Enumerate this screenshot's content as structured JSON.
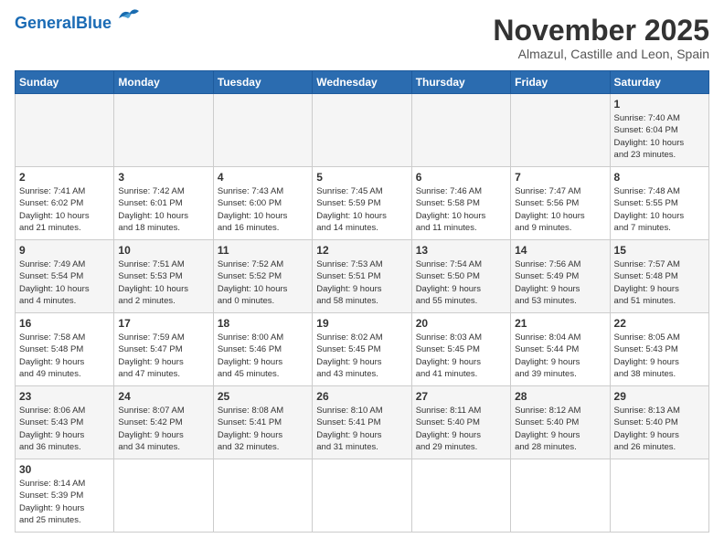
{
  "header": {
    "logo_line1": "General",
    "logo_line2": "Blue",
    "month_title": "November 2025",
    "subtitle": "Almazul, Castille and Leon, Spain"
  },
  "weekdays": [
    "Sunday",
    "Monday",
    "Tuesday",
    "Wednesday",
    "Thursday",
    "Friday",
    "Saturday"
  ],
  "weeks": [
    [
      {
        "day": "",
        "info": ""
      },
      {
        "day": "",
        "info": ""
      },
      {
        "day": "",
        "info": ""
      },
      {
        "day": "",
        "info": ""
      },
      {
        "day": "",
        "info": ""
      },
      {
        "day": "",
        "info": ""
      },
      {
        "day": "1",
        "info": "Sunrise: 7:40 AM\nSunset: 6:04 PM\nDaylight: 10 hours\nand 23 minutes."
      }
    ],
    [
      {
        "day": "2",
        "info": "Sunrise: 7:41 AM\nSunset: 6:02 PM\nDaylight: 10 hours\nand 21 minutes."
      },
      {
        "day": "3",
        "info": "Sunrise: 7:42 AM\nSunset: 6:01 PM\nDaylight: 10 hours\nand 18 minutes."
      },
      {
        "day": "4",
        "info": "Sunrise: 7:43 AM\nSunset: 6:00 PM\nDaylight: 10 hours\nand 16 minutes."
      },
      {
        "day": "5",
        "info": "Sunrise: 7:45 AM\nSunset: 5:59 PM\nDaylight: 10 hours\nand 14 minutes."
      },
      {
        "day": "6",
        "info": "Sunrise: 7:46 AM\nSunset: 5:58 PM\nDaylight: 10 hours\nand 11 minutes."
      },
      {
        "day": "7",
        "info": "Sunrise: 7:47 AM\nSunset: 5:56 PM\nDaylight: 10 hours\nand 9 minutes."
      },
      {
        "day": "8",
        "info": "Sunrise: 7:48 AM\nSunset: 5:55 PM\nDaylight: 10 hours\nand 7 minutes."
      }
    ],
    [
      {
        "day": "9",
        "info": "Sunrise: 7:49 AM\nSunset: 5:54 PM\nDaylight: 10 hours\nand 4 minutes."
      },
      {
        "day": "10",
        "info": "Sunrise: 7:51 AM\nSunset: 5:53 PM\nDaylight: 10 hours\nand 2 minutes."
      },
      {
        "day": "11",
        "info": "Sunrise: 7:52 AM\nSunset: 5:52 PM\nDaylight: 10 hours\nand 0 minutes."
      },
      {
        "day": "12",
        "info": "Sunrise: 7:53 AM\nSunset: 5:51 PM\nDaylight: 9 hours\nand 58 minutes."
      },
      {
        "day": "13",
        "info": "Sunrise: 7:54 AM\nSunset: 5:50 PM\nDaylight: 9 hours\nand 55 minutes."
      },
      {
        "day": "14",
        "info": "Sunrise: 7:56 AM\nSunset: 5:49 PM\nDaylight: 9 hours\nand 53 minutes."
      },
      {
        "day": "15",
        "info": "Sunrise: 7:57 AM\nSunset: 5:48 PM\nDaylight: 9 hours\nand 51 minutes."
      }
    ],
    [
      {
        "day": "16",
        "info": "Sunrise: 7:58 AM\nSunset: 5:48 PM\nDaylight: 9 hours\nand 49 minutes."
      },
      {
        "day": "17",
        "info": "Sunrise: 7:59 AM\nSunset: 5:47 PM\nDaylight: 9 hours\nand 47 minutes."
      },
      {
        "day": "18",
        "info": "Sunrise: 8:00 AM\nSunset: 5:46 PM\nDaylight: 9 hours\nand 45 minutes."
      },
      {
        "day": "19",
        "info": "Sunrise: 8:02 AM\nSunset: 5:45 PM\nDaylight: 9 hours\nand 43 minutes."
      },
      {
        "day": "20",
        "info": "Sunrise: 8:03 AM\nSunset: 5:45 PM\nDaylight: 9 hours\nand 41 minutes."
      },
      {
        "day": "21",
        "info": "Sunrise: 8:04 AM\nSunset: 5:44 PM\nDaylight: 9 hours\nand 39 minutes."
      },
      {
        "day": "22",
        "info": "Sunrise: 8:05 AM\nSunset: 5:43 PM\nDaylight: 9 hours\nand 38 minutes."
      }
    ],
    [
      {
        "day": "23",
        "info": "Sunrise: 8:06 AM\nSunset: 5:43 PM\nDaylight: 9 hours\nand 36 minutes."
      },
      {
        "day": "24",
        "info": "Sunrise: 8:07 AM\nSunset: 5:42 PM\nDaylight: 9 hours\nand 34 minutes."
      },
      {
        "day": "25",
        "info": "Sunrise: 8:08 AM\nSunset: 5:41 PM\nDaylight: 9 hours\nand 32 minutes."
      },
      {
        "day": "26",
        "info": "Sunrise: 8:10 AM\nSunset: 5:41 PM\nDaylight: 9 hours\nand 31 minutes."
      },
      {
        "day": "27",
        "info": "Sunrise: 8:11 AM\nSunset: 5:40 PM\nDaylight: 9 hours\nand 29 minutes."
      },
      {
        "day": "28",
        "info": "Sunrise: 8:12 AM\nSunset: 5:40 PM\nDaylight: 9 hours\nand 28 minutes."
      },
      {
        "day": "29",
        "info": "Sunrise: 8:13 AM\nSunset: 5:40 PM\nDaylight: 9 hours\nand 26 minutes."
      }
    ],
    [
      {
        "day": "30",
        "info": "Sunrise: 8:14 AM\nSunset: 5:39 PM\nDaylight: 9 hours\nand 25 minutes."
      },
      {
        "day": "",
        "info": ""
      },
      {
        "day": "",
        "info": ""
      },
      {
        "day": "",
        "info": ""
      },
      {
        "day": "",
        "info": ""
      },
      {
        "day": "",
        "info": ""
      },
      {
        "day": "",
        "info": ""
      }
    ]
  ]
}
